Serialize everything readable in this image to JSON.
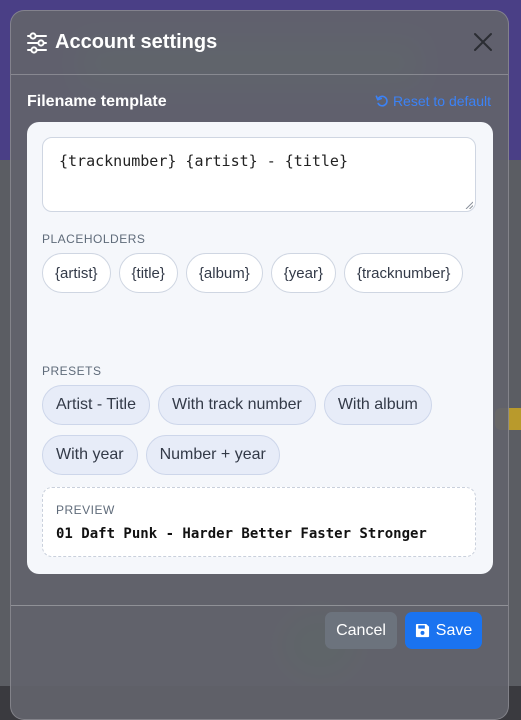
{
  "modal": {
    "title": "Account settings",
    "title_icon": "sliders-icon",
    "close_icon": "close-icon"
  },
  "section": {
    "label": "Filename template",
    "reset_label": "Reset to default",
    "reset_icon": "undo-icon"
  },
  "template": {
    "value": "{tracknumber} {artist} - {title}"
  },
  "placeholders": {
    "heading": "PLACEHOLDERS",
    "items": [
      "{artist}",
      "{title}",
      "{album}",
      "{year}",
      "{tracknumber}"
    ]
  },
  "presets": {
    "heading": "PRESETS",
    "items": [
      "Artist - Title",
      "With track number",
      "With album",
      "With year",
      "Number + year"
    ]
  },
  "preview": {
    "heading": "PREVIEW",
    "value": "01 Daft Punk - Harder Better Faster Stronger"
  },
  "footer": {
    "cancel_label": "Cancel",
    "save_label": "Save",
    "save_icon": "floppy-disk-icon"
  },
  "colors": {
    "accent": "#1a73f0",
    "link": "#3b82f6",
    "cancel": "#6c737d"
  }
}
